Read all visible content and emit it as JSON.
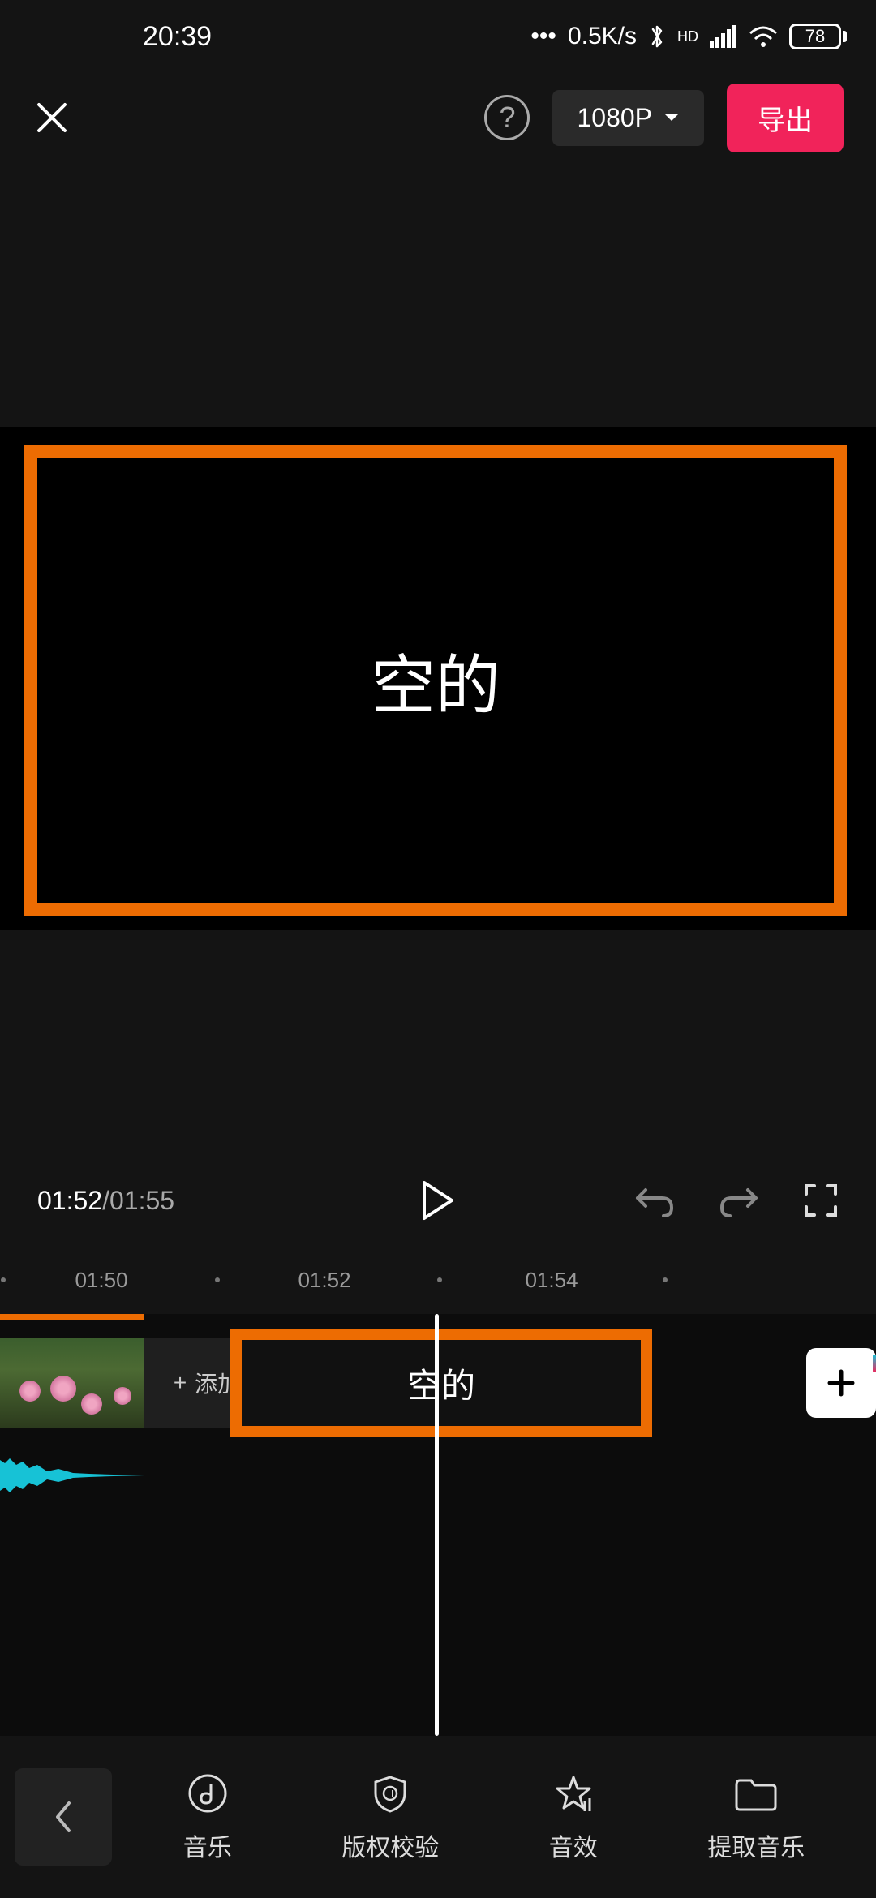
{
  "status": {
    "time": "20:39",
    "net_speed": "0.5K/s",
    "battery": "78",
    "hd": "HD"
  },
  "top": {
    "resolution": "1080P",
    "export_label": "导出"
  },
  "preview": {
    "empty_label": "空的"
  },
  "playback": {
    "current": "01:52",
    "total": "01:55"
  },
  "ruler": {
    "ticks": [
      "01:50",
      "01:52",
      "01:54"
    ]
  },
  "timeline": {
    "add_ending_label": "添加片尾",
    "empty_segment_label": "空的"
  },
  "bottom": {
    "items": [
      {
        "label": "音乐"
      },
      {
        "label": "版权校验"
      },
      {
        "label": "音效"
      },
      {
        "label": "提取音乐"
      }
    ]
  }
}
